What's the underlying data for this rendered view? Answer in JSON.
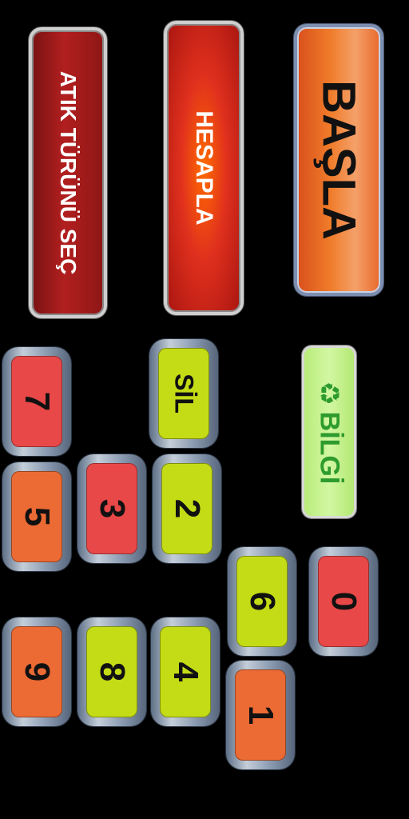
{
  "actions": {
    "waste_type_label": "ATIK TÜRÜNÜ SEÇ",
    "calculate_label": "HESAPLA",
    "start_label": "BAŞLA",
    "info_label": "BİLGİ"
  },
  "keypad": {
    "delete_label": "SİL",
    "keys": {
      "k0": "0",
      "k1": "1",
      "k2": "2",
      "k3": "3",
      "k4": "4",
      "k5": "5",
      "k6": "6",
      "k7": "7",
      "k8": "8",
      "k9": "9"
    }
  },
  "icons": {
    "info": "recycle-icon"
  },
  "colors": {
    "key_red": "#e84848",
    "key_orange": "#ec6a34",
    "key_lime": "#c4dc16",
    "start_orange": "#f07c2a",
    "calculate_red": "#e0301e",
    "waste_type_red": "#b21f1f",
    "info_green": "#2e9b2e"
  }
}
